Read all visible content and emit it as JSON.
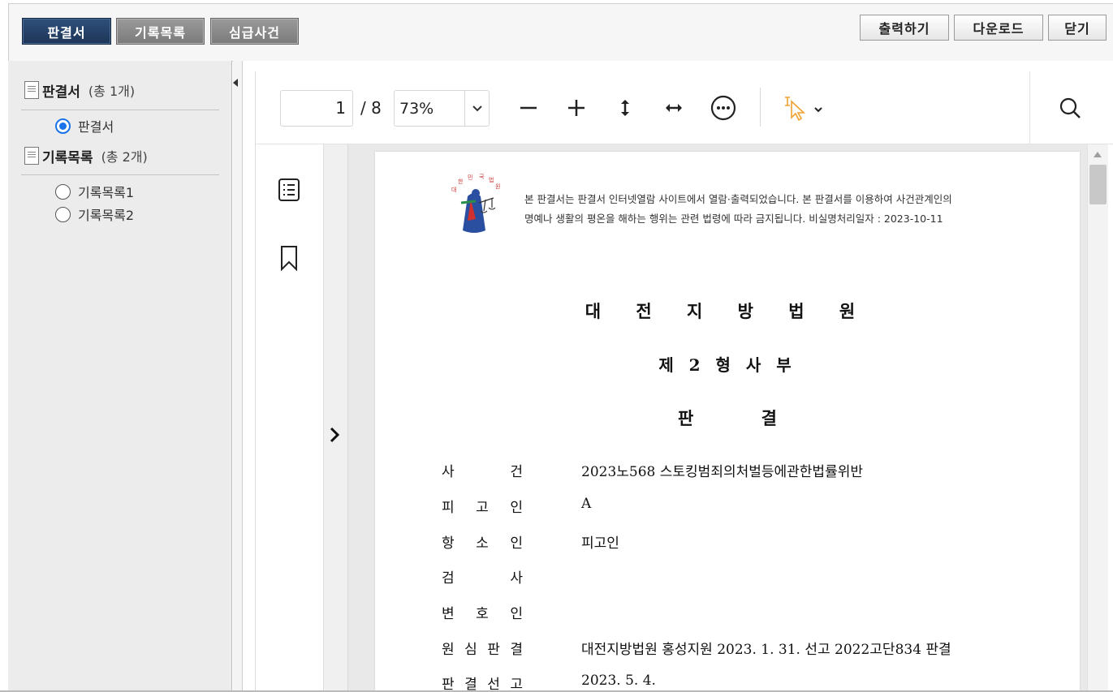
{
  "topbar": {
    "tabs": [
      {
        "label": "판결서",
        "active": true
      },
      {
        "label": "기록목록",
        "active": false
      },
      {
        "label": "심급사건",
        "active": false
      }
    ],
    "actions": {
      "print_label": "출력하기",
      "download_label": "다운로드",
      "close_label": "닫기"
    }
  },
  "sidebar": {
    "groups": [
      {
        "title": "판결서",
        "count": "(총 1개)",
        "items": [
          {
            "label": "판결서",
            "selected": true
          }
        ]
      },
      {
        "title": "기록목록",
        "count": "(총 2개)",
        "items": [
          {
            "label": "기록목록1",
            "selected": false
          },
          {
            "label": "기록목록2",
            "selected": false
          }
        ]
      }
    ]
  },
  "viewer": {
    "current_page": "1",
    "total_pages": "/ 8",
    "zoom": "73%",
    "icons": [
      "zoom-out-icon",
      "zoom-in-icon",
      "fit-height-icon",
      "fit-width-icon",
      "more-options-icon",
      "text-select-tool-icon",
      "search-icon",
      "outline-icon",
      "bookmark-icon",
      "expand-panel-icon"
    ],
    "colors": {
      "select_tool": "#f0a030",
      "radio_selected": "#1a73e8",
      "tab_active": "#1d3557",
      "tab_inactive": "#7b7b7b"
    }
  },
  "document": {
    "notice_line1": "본 판결서는 판결서 인터넷열람 사이트에서 열람·출력되었습니다. 본 판결서를 이용하여 사건관계인의",
    "notice_line2": "명예나 생활의 평온을 해하는 행위는 관련 법령에 따라 금지됩니다. 비실명처리일자 : 2023-10-11",
    "court_name": "대 전 지 방 법 원",
    "division": "제 2 형 사 부",
    "doc_type": "판 결",
    "fields": [
      {
        "label": [
          "사",
          "건"
        ],
        "value": "2023노568  스토킹범죄의처벌등에관한법률위반"
      },
      {
        "label": [
          "피",
          "고",
          "인"
        ],
        "value": "A"
      },
      {
        "label": [
          "항",
          "소",
          "인"
        ],
        "value": "피고인"
      },
      {
        "label": [
          "검",
          "사"
        ],
        "value": ""
      },
      {
        "label": [
          "변",
          "호",
          "인"
        ],
        "value": ""
      },
      {
        "label": [
          "원",
          "심",
          "판",
          "결"
        ],
        "value": "대전지방법원 홍성지원 2023. 1. 31. 선고 2022고단834 판결"
      },
      {
        "label": [
          "판",
          "결",
          "선",
          "고"
        ],
        "value": "2023. 5. 4."
      }
    ]
  }
}
